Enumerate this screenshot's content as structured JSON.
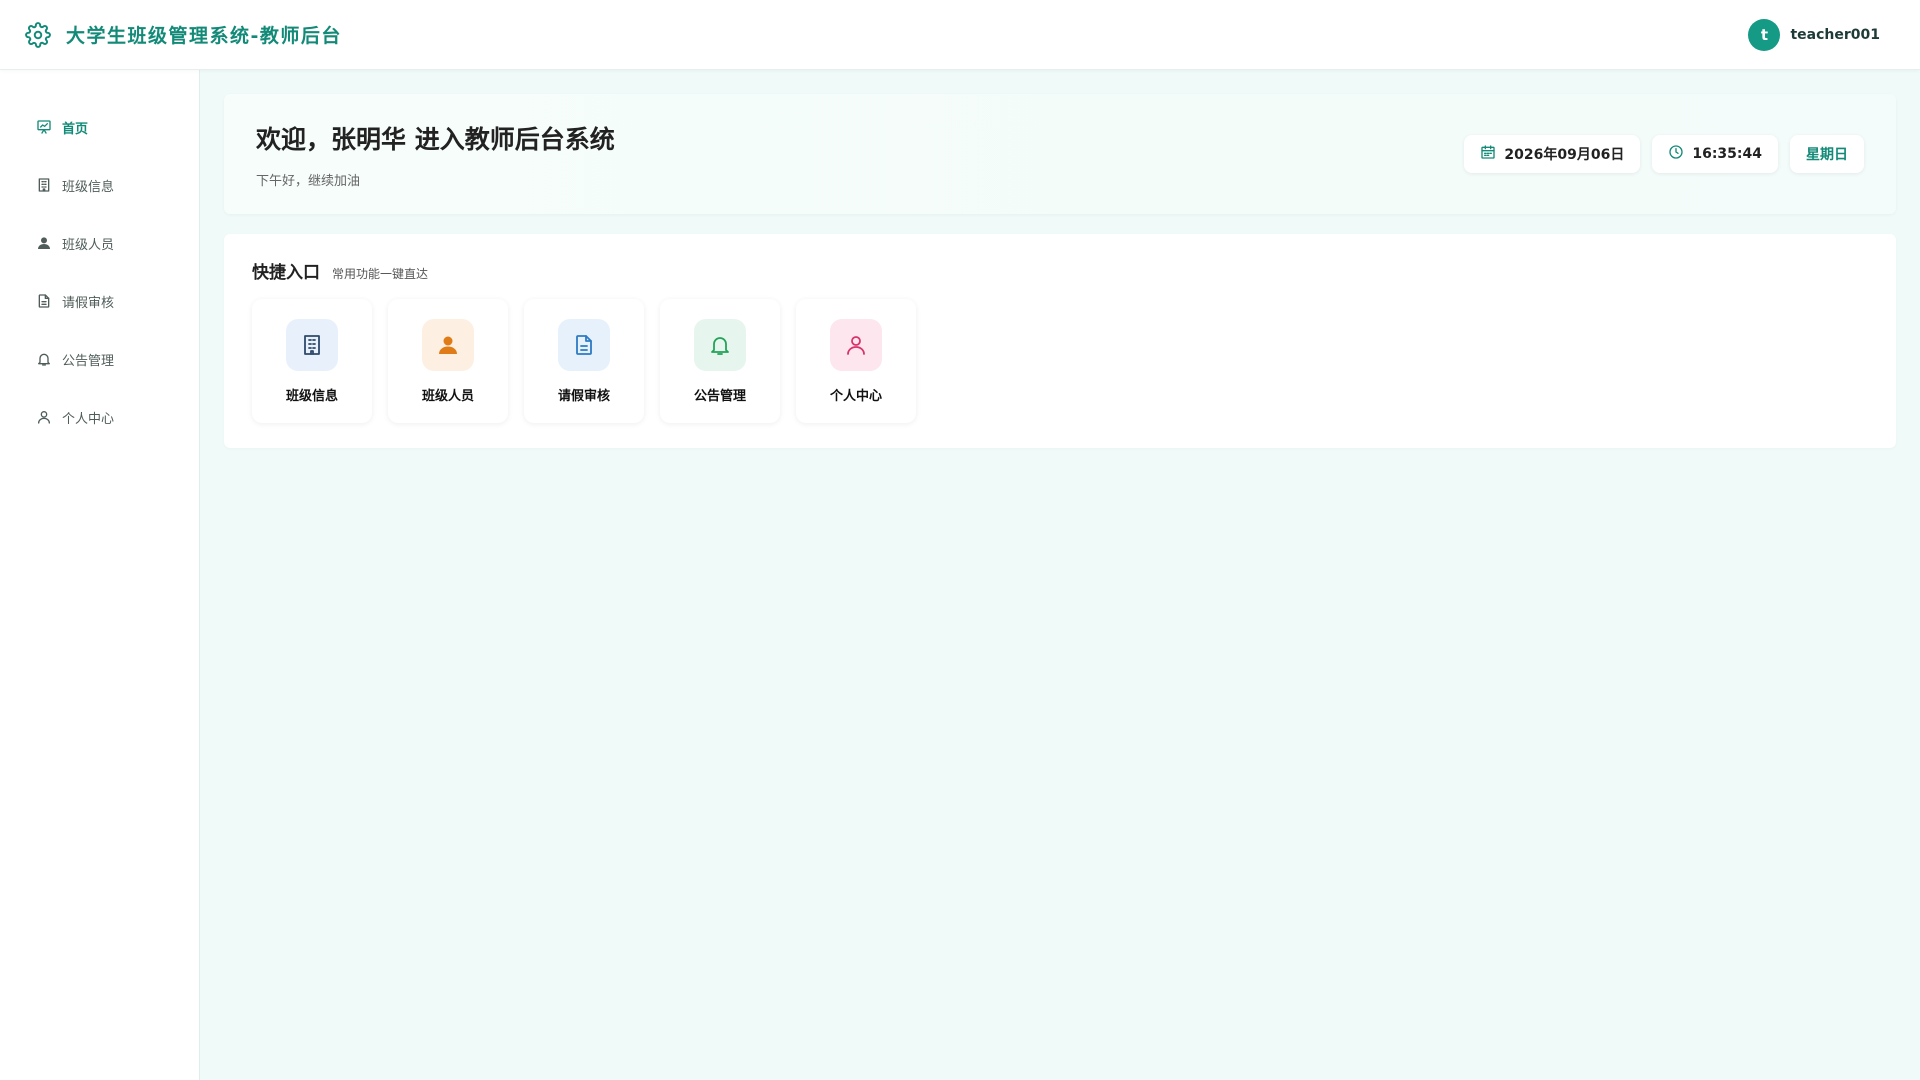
{
  "header": {
    "title": "大学生班级管理系统-教师后台",
    "logo_icon": "gear-icon",
    "user": {
      "avatar_letter": "t",
      "name": "teacher001"
    }
  },
  "colors": {
    "accent": "#138a78",
    "avatar_bg": "#159a86",
    "page_bg": "#f0faf8"
  },
  "sidebar": {
    "items": [
      {
        "label": "首页",
        "icon": "presentation-chart-icon",
        "active": true
      },
      {
        "label": "班级信息",
        "icon": "building-icon",
        "active": false
      },
      {
        "label": "班级人员",
        "icon": "user-icon",
        "active": false
      },
      {
        "label": "请假审核",
        "icon": "document-icon",
        "active": false
      },
      {
        "label": "公告管理",
        "icon": "bell-icon",
        "active": false
      },
      {
        "label": "个人中心",
        "icon": "user-outline-icon",
        "active": false
      }
    ]
  },
  "welcome": {
    "title": "欢迎，张明华 进入教师后台系统",
    "subtitle": "下午好，继续加油",
    "date": "2026年09月06日",
    "time": "16:35:44",
    "weekday": "星期日"
  },
  "quick": {
    "title": "快捷入口",
    "subtitle": "常用功能一键直达",
    "items": [
      {
        "label": "班级信息",
        "icon": "building-icon",
        "bg": "#e8f1fb",
        "color": "#2f4a6b"
      },
      {
        "label": "班级人员",
        "icon": "user-icon",
        "bg": "#fdf0e2",
        "color": "#e07c18"
      },
      {
        "label": "请假审核",
        "icon": "document-icon",
        "bg": "#e6f1fb",
        "color": "#2c7bc4"
      },
      {
        "label": "公告管理",
        "icon": "bell-icon",
        "bg": "#e6f6ee",
        "color": "#22a35a"
      },
      {
        "label": "个人中心",
        "icon": "user-outline-icon",
        "bg": "#fde6ee",
        "color": "#d6336c"
      }
    ]
  }
}
